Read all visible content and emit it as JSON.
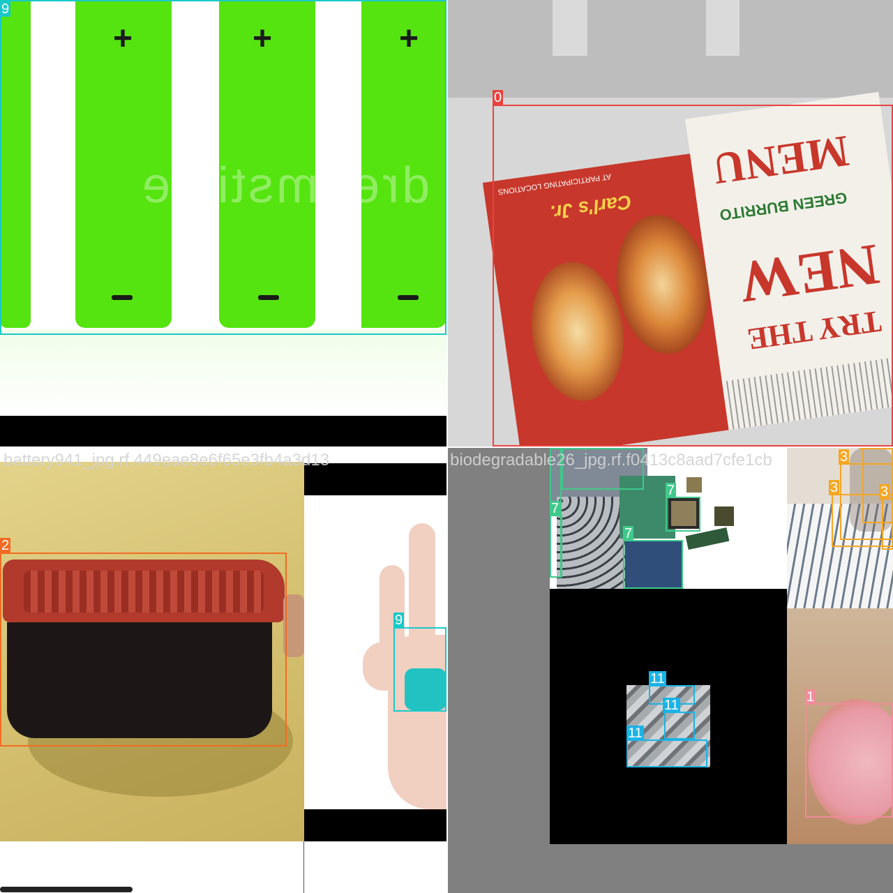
{
  "colors": {
    "class_0": "#e8433f",
    "class_1": "#f28b9a",
    "class_2": "#f26b22",
    "class_3": "#f5a623",
    "class_7": "#3fc98b",
    "class_9": "#19c9c9",
    "class_11": "#1ab3e6",
    "battery_green": "#55e40f",
    "tray_red": "#b13a2c",
    "sand": "#d6c273"
  },
  "tiles": {
    "top_left": {
      "battery_signs": {
        "plus": "+",
        "minus": "−"
      },
      "watermark": "dreamstime",
      "labels": [
        "9"
      ]
    },
    "top_right": {
      "flyer": {
        "line1": "TRY THE",
        "line2": "NEW",
        "brand": "GREEN BURRITO",
        "line3": "MENU",
        "logo": "Carl's Jr.",
        "footer": "AT PARTICIPATING LOCATIONS"
      },
      "labels": [
        "0"
      ]
    },
    "bottom_left": {
      "filename": "battery941_jpg.rf.449eae8e6f65e3fb4a3d13",
      "labels": [
        "2",
        "9"
      ]
    },
    "bottom_right": {
      "filename": "biodegradable26",
      "filename_suffix": "_jpg.rf.f0413c8aad7cfe1cb",
      "labels": [
        "7",
        "7",
        "7",
        "7",
        "7",
        "3",
        "3",
        "3",
        "3",
        "11",
        "11",
        "11",
        "1"
      ]
    }
  }
}
